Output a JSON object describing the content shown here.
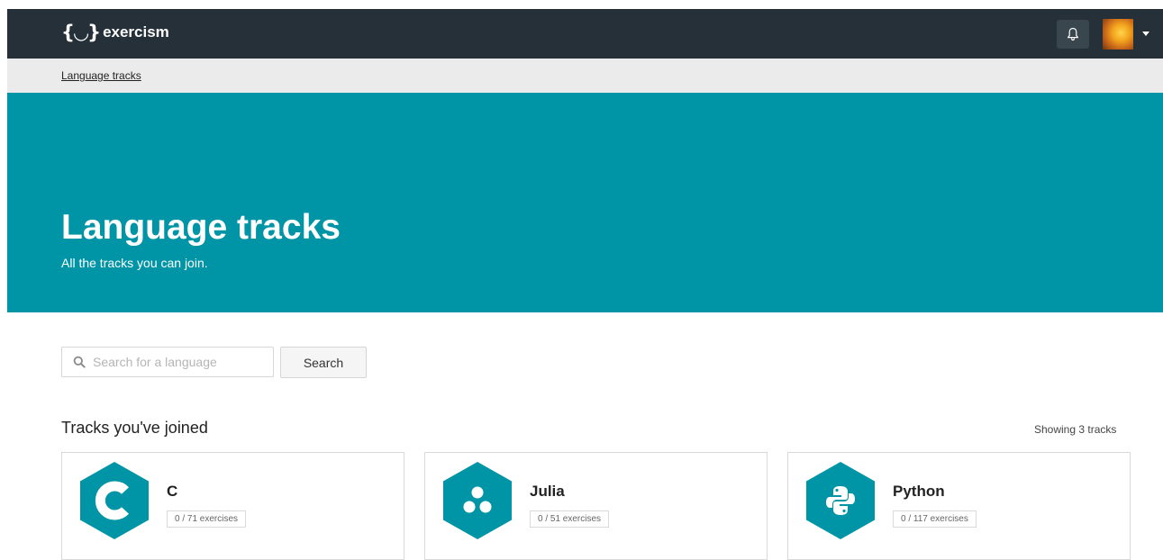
{
  "header": {
    "logo_mark": "{◡}",
    "logo_text": "exercism"
  },
  "breadcrumb": {
    "label": "Language tracks"
  },
  "hero": {
    "title": "Language tracks",
    "subtitle": "All the tracks you can join."
  },
  "search": {
    "placeholder": "Search for a language",
    "value": "",
    "button_label": "Search"
  },
  "joined": {
    "heading": "Tracks you've joined",
    "showing": "Showing 3 tracks",
    "tracks": [
      {
        "name": "C",
        "exercises": "0 / 71 exercises",
        "icon": "c-logo-icon"
      },
      {
        "name": "Julia",
        "exercises": "0 / 51 exercises",
        "icon": "julia-logo-icon"
      },
      {
        "name": "Python",
        "exercises": "0 / 117 exercises",
        "icon": "python-logo-icon"
      }
    ]
  },
  "colors": {
    "header_bg": "#253038",
    "accent": "#0095a6",
    "breadcrumb_bg": "#ebebeb"
  }
}
